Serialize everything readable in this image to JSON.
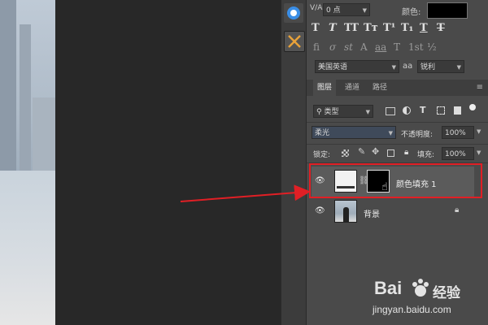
{
  "character_panel": {
    "tracking_value": "0 点",
    "color_label": "颜色:",
    "language": "美国英语",
    "aa_icon": "aa",
    "antialias": "锐利",
    "color_swatch": "#000000"
  },
  "tabs": {
    "layers": "图层",
    "channels": "通道",
    "paths": "路径"
  },
  "filter": {
    "kind_label": "类型"
  },
  "blend": {
    "mode": "柔光",
    "opacity_label": "不透明度:",
    "opacity_value": "100%"
  },
  "lock": {
    "label": "锁定:",
    "fill_label": "填充:",
    "fill_value": "100%"
  },
  "layers": [
    {
      "name": "颜色填充 1"
    },
    {
      "name": "背景"
    }
  ],
  "watermark": {
    "brand_a": "Bai",
    "brand_b": "经验",
    "url": "jingyan.baidu.com"
  },
  "colors": {
    "highlight": "#e11f25",
    "panel": "#4a4a4a",
    "canvas": "#282828"
  }
}
